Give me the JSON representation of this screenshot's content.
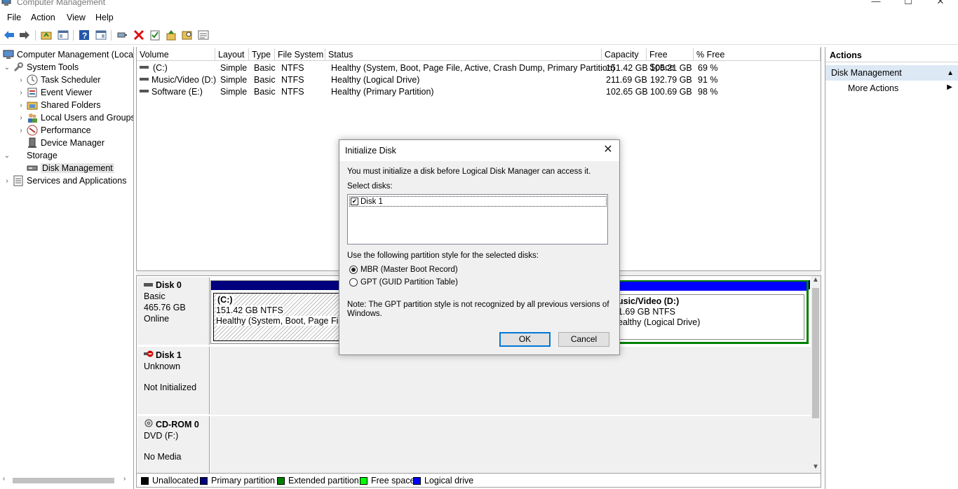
{
  "window": {
    "title": "Computer Management",
    "controls": {
      "minimize": "—",
      "maximize": "☐",
      "close": "✕"
    }
  },
  "menu": [
    "File",
    "Action",
    "View",
    "Help"
  ],
  "tree": {
    "root": "Computer Management (Local",
    "system_tools": "System Tools",
    "task_scheduler": "Task Scheduler",
    "event_viewer": "Event Viewer",
    "shared_folders": "Shared Folders",
    "local_users": "Local Users and Groups",
    "performance": "Performance",
    "device_manager": "Device Manager",
    "storage": "Storage",
    "disk_management": "Disk Management",
    "services": "Services and Applications"
  },
  "volume_list": {
    "columns": [
      "Volume",
      "Layout",
      "Type",
      "File System",
      "Status",
      "Capacity",
      "Free Space",
      "% Free"
    ],
    "rows": [
      [
        "(C:)",
        "Simple",
        "Basic",
        "NTFS",
        "Healthy (System, Boot, Page File, Active, Crash Dump, Primary Partition)",
        "151.42 GB",
        "105.21 GB",
        "69 %"
      ],
      [
        "Music/Video (D:)",
        "Simple",
        "Basic",
        "NTFS",
        "Healthy (Logical Drive)",
        "211.69 GB",
        "192.79 GB",
        "91 %"
      ],
      [
        "Software (E:)",
        "Simple",
        "Basic",
        "NTFS",
        "Healthy (Primary Partition)",
        "102.65 GB",
        "100.69 GB",
        "98 %"
      ]
    ]
  },
  "disks": {
    "disk0": {
      "name": "Disk 0",
      "type": "Basic",
      "size": "465.76 GB",
      "state": "Online"
    },
    "disk1": {
      "name": "Disk 1",
      "type": "Unknown",
      "state": "Not Initialized"
    },
    "cdrom0": {
      "name": "CD-ROM 0",
      "type": "DVD (F:)",
      "state": "No Media"
    },
    "partitions": {
      "c": {
        "name": "(C:)",
        "size": "151.42 GB NTFS",
        "status": "Healthy (System, Boot, Page File,"
      },
      "d": {
        "name": "usic/Video  (D:)",
        "size": "1.69 GB NTFS",
        "status": "ealthy (Logical Drive)"
      }
    }
  },
  "legend": [
    {
      "label": "Unallocated",
      "color": "#000000"
    },
    {
      "label": "Primary partition",
      "color": "#00007f"
    },
    {
      "label": "Extended partition",
      "color": "#008000"
    },
    {
      "label": "Free space",
      "color": "#00ff00"
    },
    {
      "label": "Logical drive",
      "color": "#0000ff"
    }
  ],
  "actions": {
    "header": "Actions",
    "section": "Disk Management",
    "more": "More Actions"
  },
  "dialog": {
    "title": "Initialize Disk",
    "intro": "You must initialize a disk before Logical Disk Manager can access it.",
    "select_label": "Select disks:",
    "disk_item": "Disk 1",
    "style_label": "Use the following partition style for the selected disks:",
    "mbr": "MBR (Master Boot Record)",
    "gpt": "GPT (GUID Partition Table)",
    "note_line1": "Note: The GPT partition style is not recognized by all previous versions of",
    "note_line2": "Windows.",
    "ok": "OK",
    "cancel": "Cancel",
    "close": "✕"
  },
  "colors": {
    "primary_bar": "#00007f",
    "logical_bar": "#0000ff",
    "extended_border": "#008000",
    "selection_bg": "#dce8f4",
    "default_button_border": "#0078d7"
  }
}
